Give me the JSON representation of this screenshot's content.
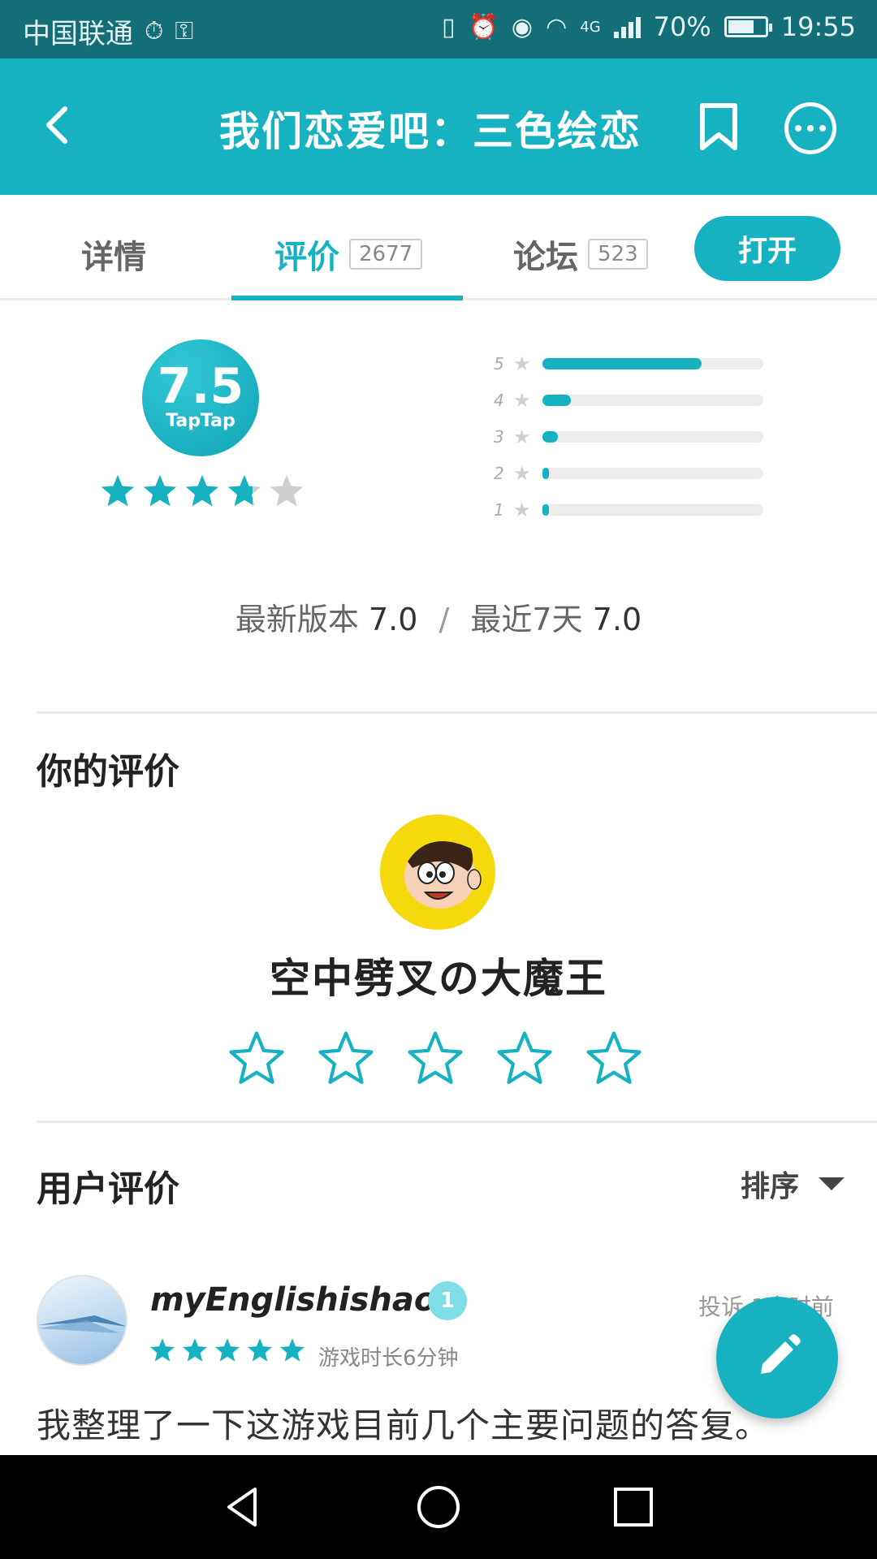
{
  "status_bar": {
    "carrier": "中国联通",
    "network": "4G",
    "battery": "70%",
    "battery_level": 0.7,
    "time": "19:55"
  },
  "app_bar": {
    "title": "我们恋爱吧：三色绘恋",
    "icons": [
      "back-arrow-icon",
      "bookmark-icon",
      "more-icon"
    ]
  },
  "tabs": {
    "details": "详情",
    "reviews": "评价",
    "reviews_count": "2677",
    "forum": "论坛",
    "forum_count": "523",
    "active": "reviews",
    "open_button": "打开"
  },
  "rating": {
    "score": "7.5",
    "brand": "TapTap",
    "stars": 3.75,
    "distribution": [
      {
        "label": "5",
        "fraction": 0.72
      },
      {
        "label": "4",
        "fraction": 0.13
      },
      {
        "label": "3",
        "fraction": 0.07
      },
      {
        "label": "2",
        "fraction": 0.02
      },
      {
        "label": "1",
        "fraction": 0.03
      }
    ],
    "latest_version_label": "最新版本",
    "latest_version_score": "7.0",
    "separator": "/",
    "recent_label": "最近7天",
    "recent_score": "7.0"
  },
  "my_review": {
    "heading": "你的评价",
    "username": "空中劈叉の大魔王",
    "star_count": 5
  },
  "user_reviews": {
    "heading": "用户评价",
    "sort_label": "排序",
    "items": [
      {
        "username": "myEnglishishao",
        "level": "1",
        "time": "投诉 1小时前",
        "stars": 5,
        "playtime": "游戏时长6分钟",
        "text": "我整理了一下这游戏目前几个主要问题的答复。"
      }
    ]
  },
  "colors": {
    "accent": "#17b2c2",
    "status_bar": "#136e77",
    "star_inactive": "#cfcfcf"
  }
}
